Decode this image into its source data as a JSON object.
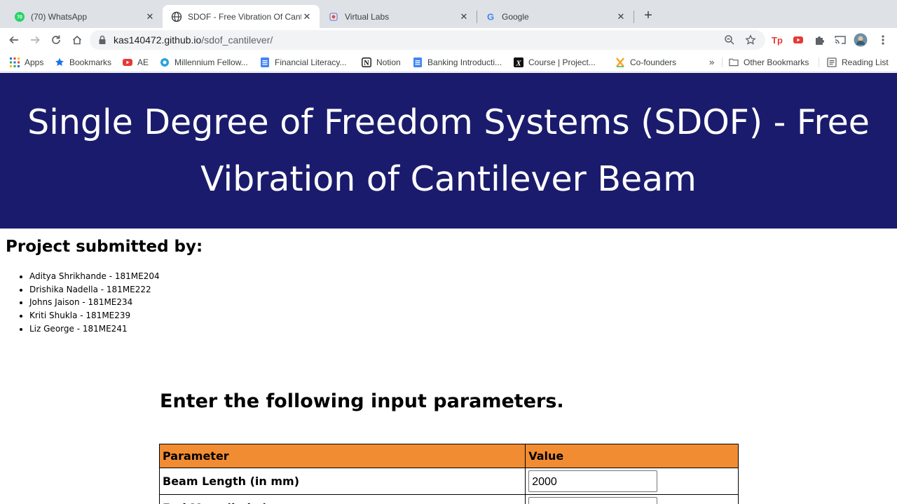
{
  "browser": {
    "tabs": [
      {
        "title": "(70) WhatsApp",
        "badge": "70",
        "active": false
      },
      {
        "title": "SDOF - Free Vibration Of Cantil",
        "active": true
      },
      {
        "title": "Virtual Labs",
        "active": false
      },
      {
        "title": "Google",
        "active": false
      }
    ],
    "url_host": "kas140472.github.io",
    "url_path": "/sdof_cantilever/",
    "bookmarks": [
      {
        "label": "Apps",
        "icon": "apps-grid-icon"
      },
      {
        "label": "Bookmarks",
        "icon": "star-icon"
      },
      {
        "label": "AE",
        "icon": "youtube-icon"
      },
      {
        "label": "Millennium Fellow...",
        "icon": "globe-icon"
      },
      {
        "label": "Financial Literacy...",
        "icon": "docs-icon"
      },
      {
        "label": "Notion",
        "icon": "notion-icon"
      },
      {
        "label": "Banking Introducti...",
        "icon": "docs-icon"
      },
      {
        "label": "Course | Project...",
        "icon": "x-logo-icon"
      },
      {
        "label": "Co-founders",
        "icon": "cofounder-icon"
      }
    ],
    "overflow_label": "»",
    "other_bookmarks": "Other Bookmarks",
    "reading_list": "Reading List"
  },
  "page": {
    "title": "Single Degree of Freedom Systems (SDOF) - Free Vibration of Cantilever Beam",
    "submitted_heading": "Project submitted by:",
    "members": [
      "Aditya Shrikhande - 181ME204",
      "Drishika Nadella - 181ME222",
      "Johns Jaison - 181ME234",
      "Kriti Shukla - 181ME239",
      "Liz George - 181ME241"
    ],
    "params_heading": "Enter the following input parameters.",
    "table": {
      "header_parameter": "Parameter",
      "header_value": "Value",
      "rows": [
        {
          "label": "Beam Length (in mm)",
          "value": "2000"
        },
        {
          "label": "End Mass (in kg)",
          "value": ""
        }
      ]
    }
  },
  "colors": {
    "banner_bg": "#1b1b6d",
    "table_header_bg": "#f28c33"
  }
}
